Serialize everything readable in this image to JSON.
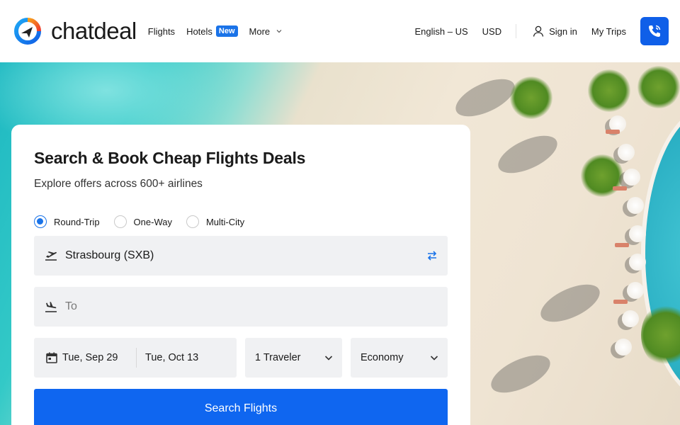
{
  "header": {
    "brand": "chatdeal",
    "nav": [
      {
        "label": "Flights"
      },
      {
        "label": "Hotels",
        "badge": "New"
      },
      {
        "label": "More"
      }
    ],
    "language": "English – US",
    "currency": "USD",
    "sign_in": "Sign in",
    "my_trips": "My Trips",
    "phone_icon": "phone-icon"
  },
  "search": {
    "title": "Search & Book Cheap Flights Deals",
    "subtitle": "Explore offers across 600+ airlines",
    "trip_types": [
      {
        "label": "Round-Trip",
        "selected": true
      },
      {
        "label": "One-Way",
        "selected": false
      },
      {
        "label": "Multi-City",
        "selected": false
      }
    ],
    "from_value": "Strasbourg (SXB)",
    "to_placeholder": "To",
    "depart_date": "Tue, Sep 29",
    "return_date": "Tue, Oct 13",
    "travelers": "1 Traveler",
    "cabin": "Economy",
    "button_label": "Search Flights"
  },
  "colors": {
    "accent": "#0f66f0",
    "badge": "#1a73e8",
    "field_bg": "#f0f1f3"
  }
}
